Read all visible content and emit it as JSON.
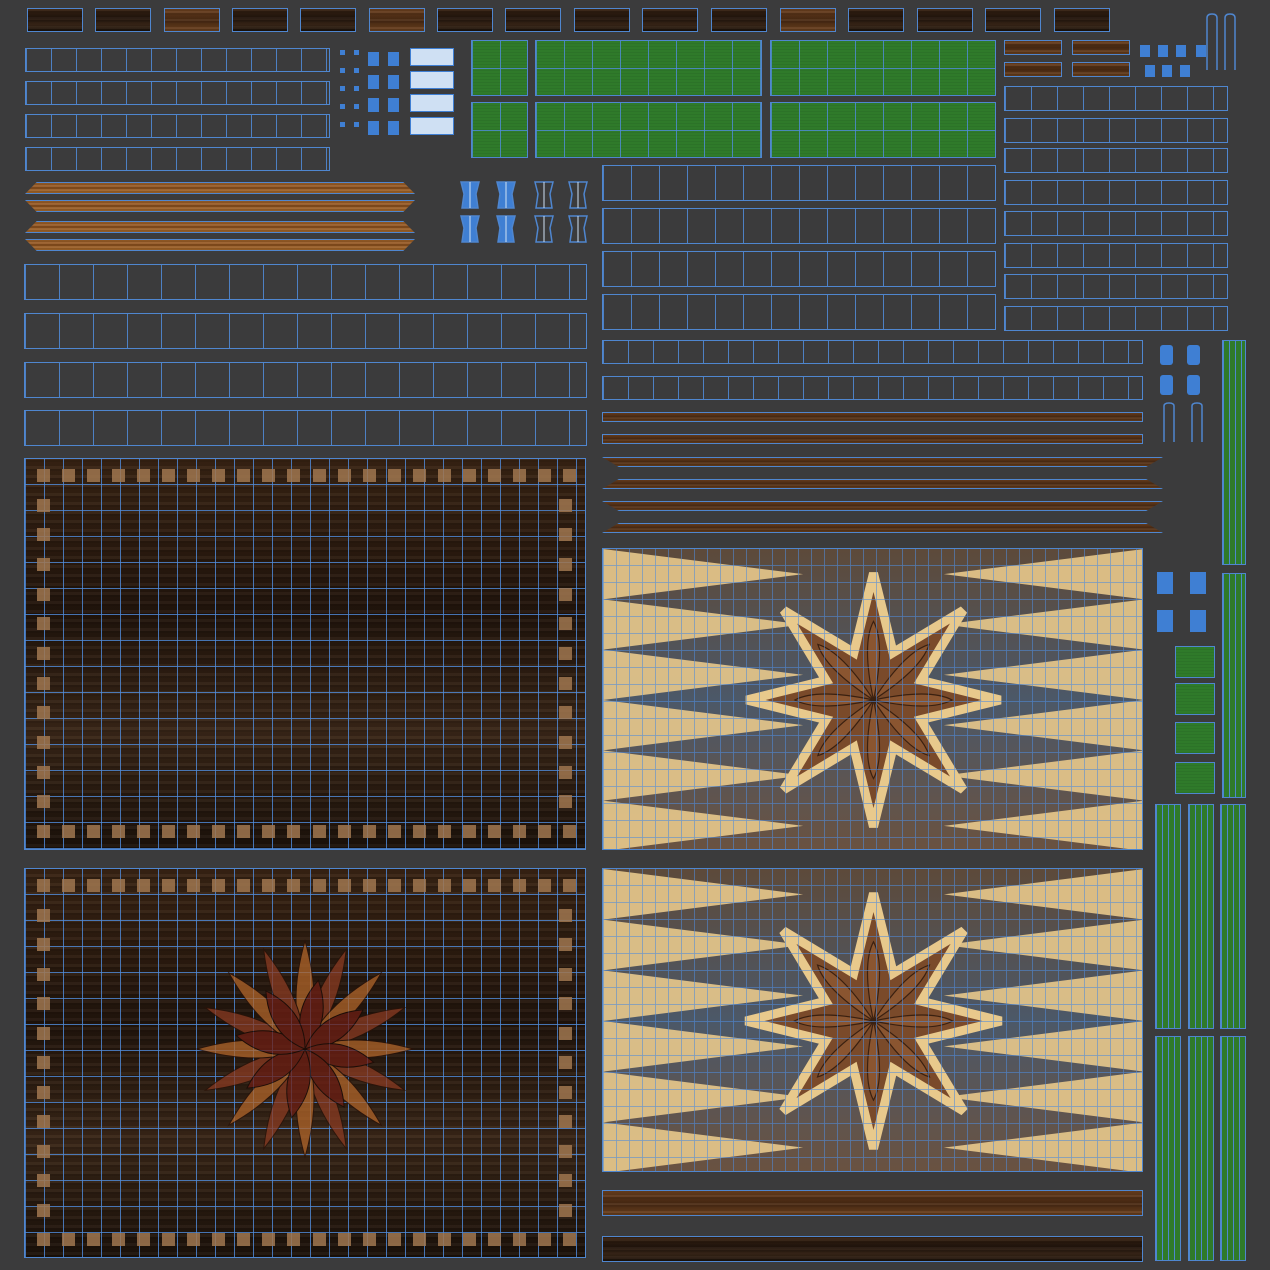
{
  "colors": {
    "background": "#3b3b3c",
    "uv_wire": "#4f86cf",
    "felt_green": "#2f7a2a",
    "wood_dark": "#2a190d",
    "wood_light": "#a2642a",
    "inlay_light": "#e8c98c"
  },
  "icons": [
    "pawn-icon",
    "pawn-icon",
    "pawn-icon",
    "pawn-icon",
    "hook-icon",
    "clip-icon"
  ]
}
